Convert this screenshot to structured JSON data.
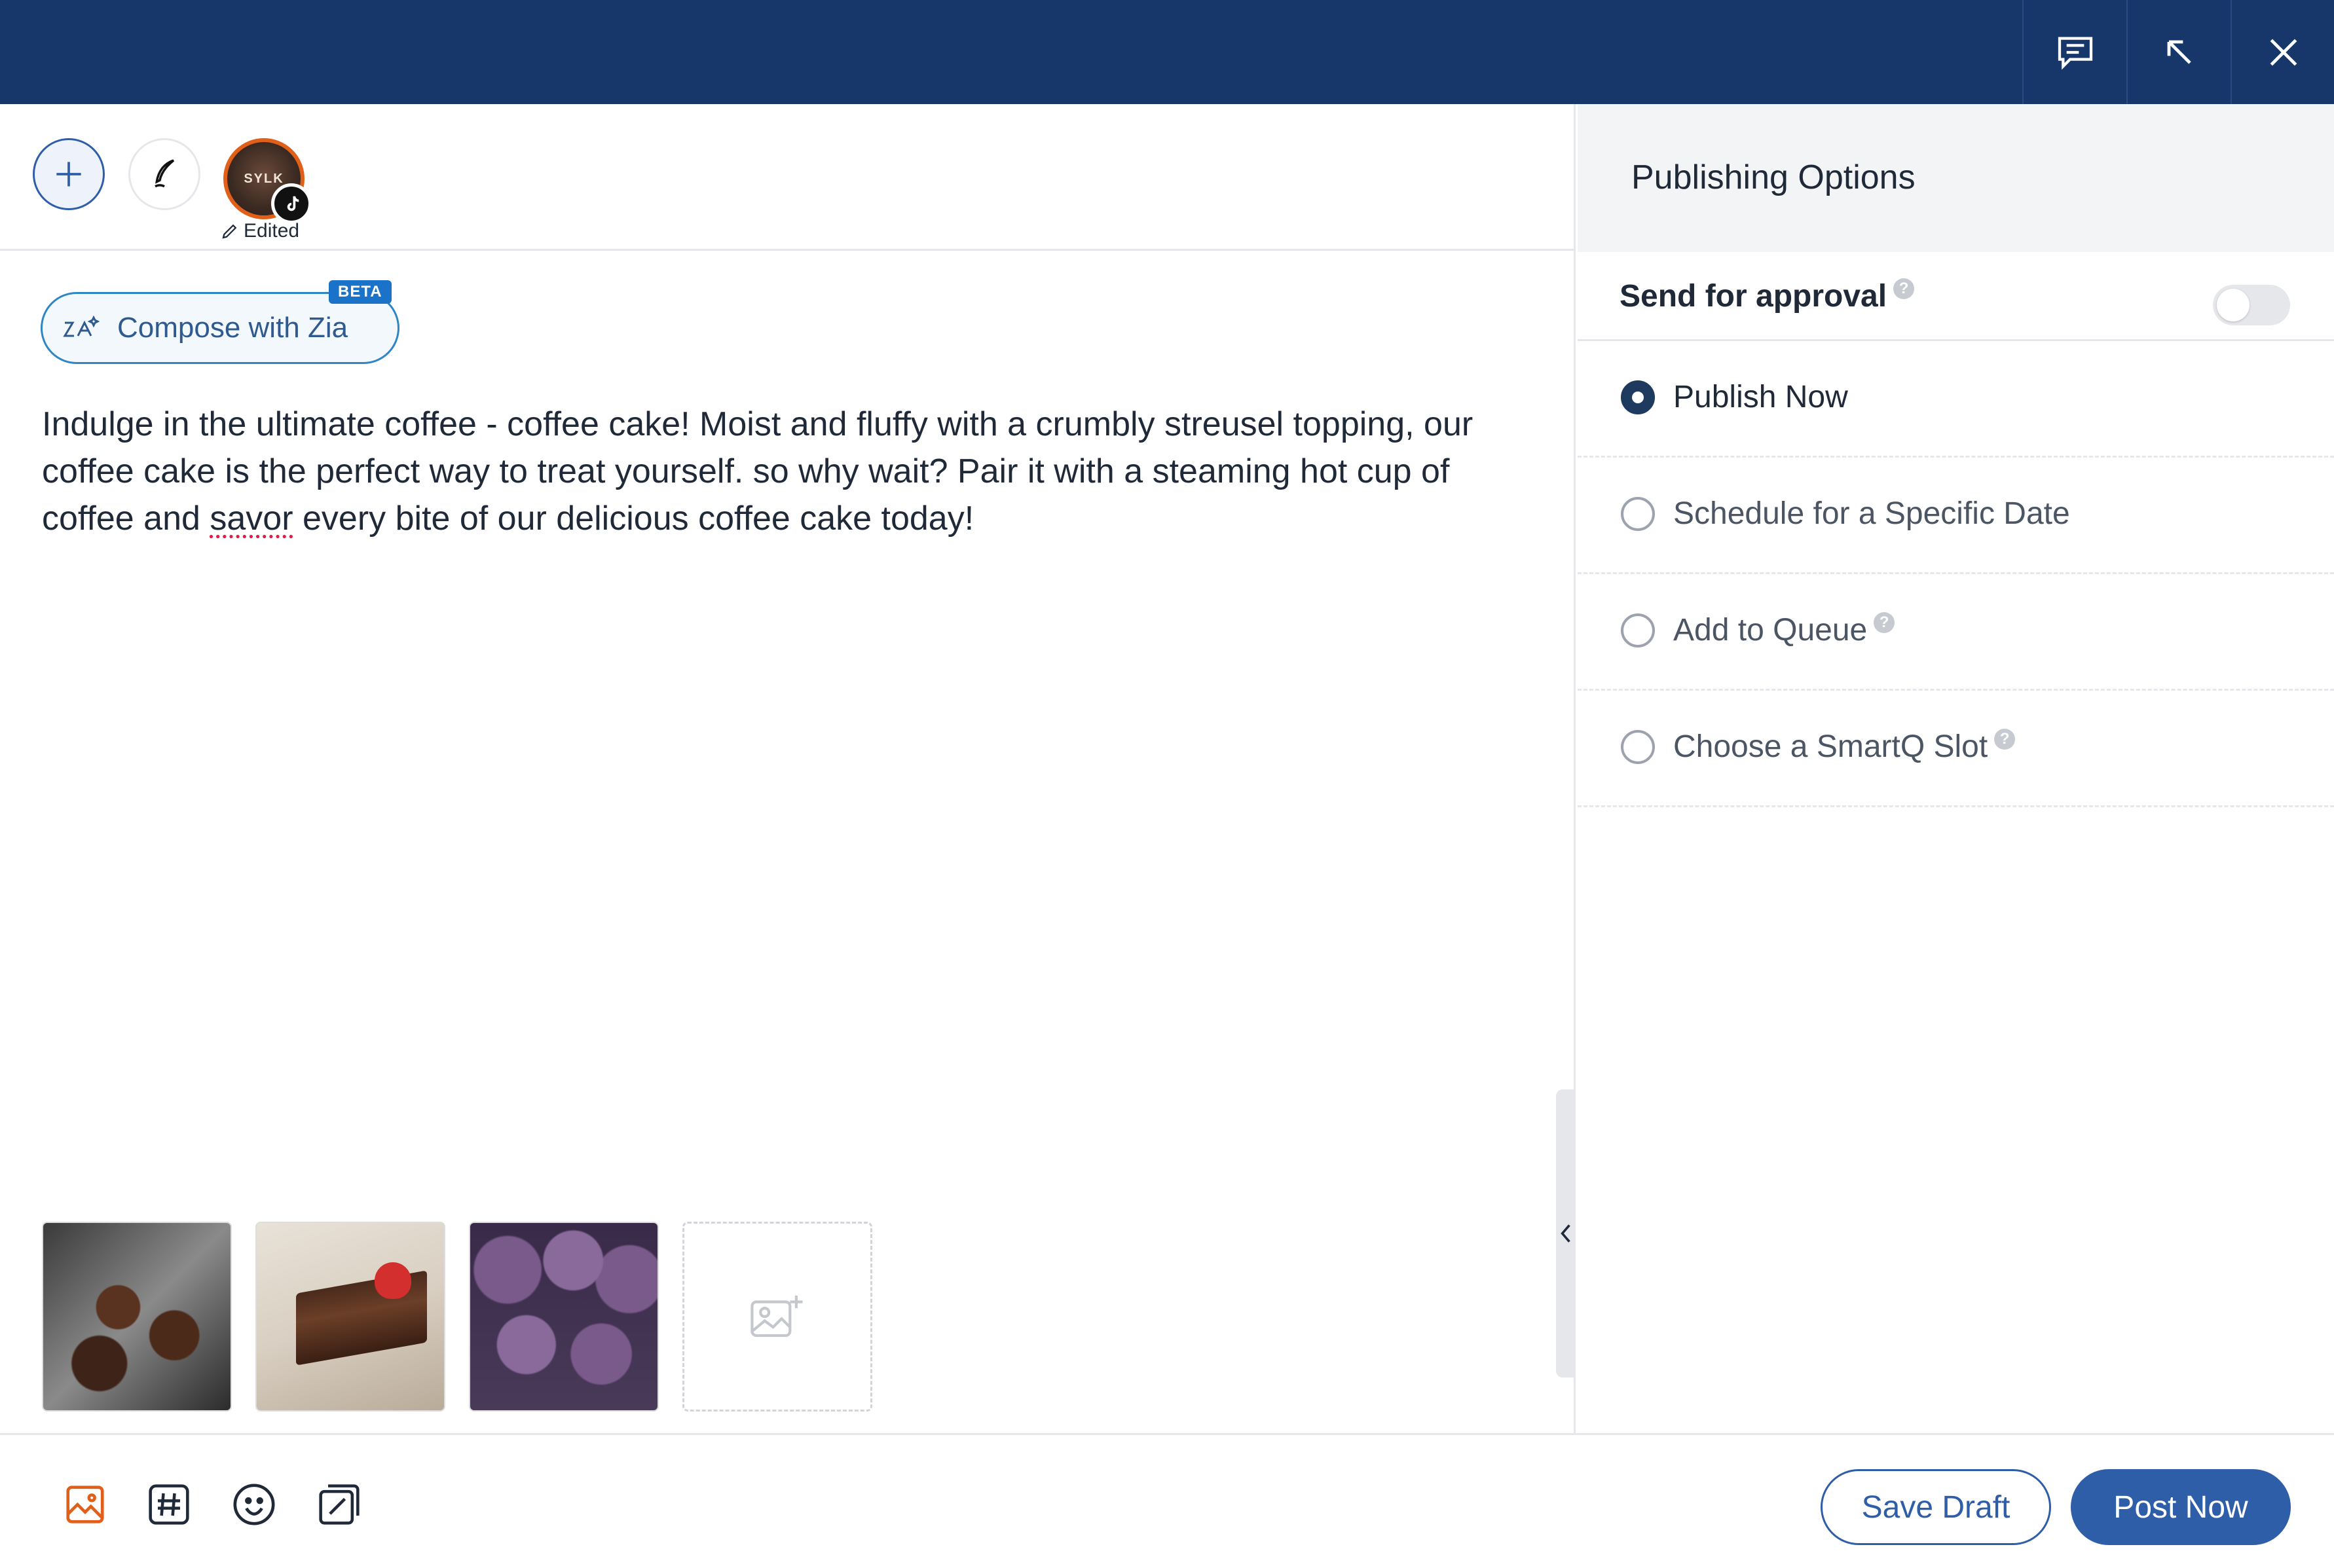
{
  "account": {
    "avatar_text": "SYLK",
    "edited_label": "Edited"
  },
  "composer": {
    "zia_label": "Compose with Zia",
    "beta_badge": "BETA",
    "text_part1": "Indulge in the ultimate coffee - coffee cake! Moist and fluffy with a crumbly streusel topping, our coffee cake is the perfect way to treat yourself. so why wait? Pair it with a steaming hot cup of coffee and ",
    "text_misspelled": "savor",
    "text_part2": " every bite of our delicious coffee cake today!"
  },
  "panel": {
    "title": "Publishing Options",
    "approval_label": "Send for approval",
    "approval_enabled": false,
    "options": [
      {
        "label": "Publish Now",
        "selected": true
      },
      {
        "label": "Schedule for a Specific Date",
        "selected": false
      },
      {
        "label": "Add to Queue",
        "selected": false
      },
      {
        "label": "Choose a SmartQ Slot",
        "selected": false
      }
    ],
    "help_glyph": "?"
  },
  "footer": {
    "save_draft": "Save Draft",
    "post_now": "Post Now"
  },
  "colors": {
    "topbar": "#17376b",
    "primary": "#2f5ea8",
    "accent_orange": "#e0601a"
  }
}
